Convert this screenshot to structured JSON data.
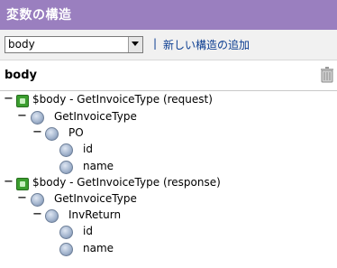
{
  "title": "変数の構造",
  "toolbar": {
    "selected": "body",
    "separator": "|",
    "add_link": "新しい構造の追加"
  },
  "header": {
    "name": "body"
  },
  "tree": {
    "n1": "$body - GetInvoiceType (request)",
    "n2": "GetInvoiceType",
    "n3": "PO",
    "n4": "id",
    "n5": "name",
    "n6": "$body - GetInvoiceType (response)",
    "n7": "GetInvoiceType",
    "n8": "InvReturn",
    "n9": "id",
    "n10": "name"
  },
  "icons": {
    "root": "green-box-icon",
    "field": "circle-node-icon",
    "delete": "trash-icon"
  }
}
